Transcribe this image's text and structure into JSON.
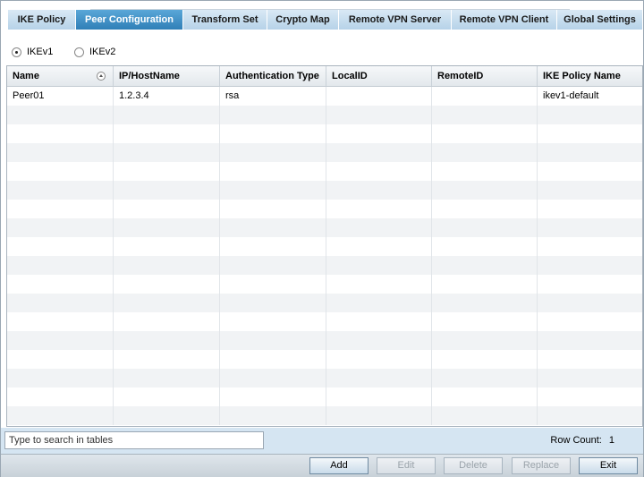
{
  "tabs": [
    {
      "label": "IKE Policy",
      "active": false
    },
    {
      "label": "Peer Configuration",
      "active": true
    },
    {
      "label": "Transform Set",
      "active": false
    },
    {
      "label": "Crypto Map",
      "active": false
    },
    {
      "label": "Remote VPN Server",
      "active": false
    },
    {
      "label": "Remote VPN Client",
      "active": false
    },
    {
      "label": "Global Settings",
      "active": false
    }
  ],
  "version": {
    "options": [
      {
        "label": "IKEv1",
        "selected": true
      },
      {
        "label": "IKEv2",
        "selected": false
      }
    ]
  },
  "table": {
    "columns": [
      "Name",
      "IP/HostName",
      "Authentication Type",
      "LocalID",
      "RemoteID",
      "IKE Policy Name"
    ],
    "rows": [
      [
        "Peer01",
        "1.2.3.4",
        "rsa",
        "",
        "",
        "ikev1-default"
      ]
    ]
  },
  "footer": {
    "search_placeholder": "Type to search in tables",
    "row_count_label": "Row  Count:",
    "row_count_value": "1"
  },
  "buttons": {
    "add": "Add",
    "edit": "Edit",
    "delete": "Delete",
    "replace": "Replace",
    "exit": "Exit"
  }
}
